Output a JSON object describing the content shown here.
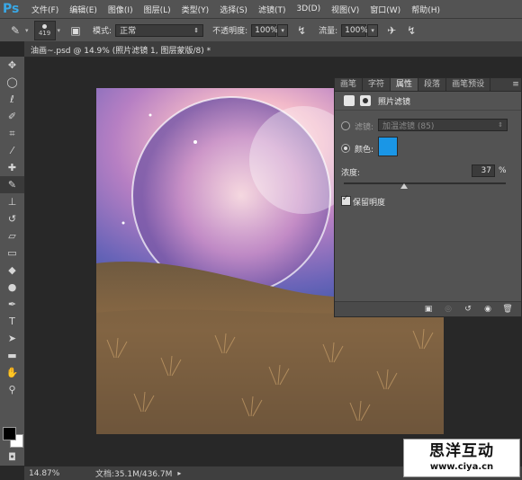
{
  "app": {
    "logo": "Ps"
  },
  "menu": [
    "文件(F)",
    "编辑(E)",
    "图像(I)",
    "图层(L)",
    "类型(Y)",
    "选择(S)",
    "滤镜(T)",
    "3D(D)",
    "视图(V)",
    "窗口(W)",
    "帮助(H)"
  ],
  "options": {
    "brush_size": "419",
    "mode_label": "模式:",
    "mode_value": "正常",
    "opacity_label": "不透明度:",
    "opacity_value": "100%",
    "flow_label": "流量:",
    "flow_value": "100%"
  },
  "document": {
    "tab_title": "油画~.psd @ 14.9% (照片滤镜 1, 图层蒙版/8) *"
  },
  "panel": {
    "tabs": [
      "画笔",
      "字符",
      "属性",
      "段落",
      "画笔预设"
    ],
    "active_tab_index": 2,
    "title": "照片滤镜",
    "filter_label": "滤镜:",
    "filter_value": "加温滤镜 (85)",
    "filter_selected": false,
    "color_label": "颜色:",
    "color_selected": true,
    "color_value": "#1a96e6",
    "density_label": "浓度:",
    "density_value": "37",
    "density_unit": "%",
    "density_fraction": 0.37,
    "preserve_label": "保留明度",
    "preserve_checked": true
  },
  "status": {
    "zoom": "14.87%",
    "doc_info": "文档:35.1M/436.7M"
  },
  "watermark": {
    "line1": "思洋互动",
    "line2": "www.ciya.cn"
  },
  "icons": {
    "tools": [
      "move-icon",
      "marquee-icon",
      "lasso-icon",
      "quick-select-icon",
      "crop-icon",
      "eyedropper-icon",
      "healing-icon",
      "brush-icon",
      "stamp-icon",
      "history-brush-icon",
      "eraser-icon",
      "gradient-icon",
      "blur-icon",
      "dodge-icon",
      "pen-icon",
      "type-icon",
      "path-select-icon",
      "shape-icon",
      "hand-icon",
      "zoom-icon"
    ]
  }
}
